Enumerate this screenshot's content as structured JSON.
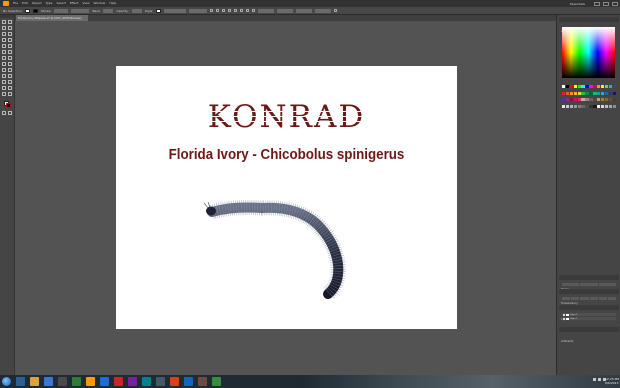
{
  "app": {
    "menu": [
      "Ai",
      "File",
      "Edit",
      "Object",
      "Type",
      "Select",
      "Effect",
      "View",
      "Window",
      "Help"
    ],
    "workspace": "Essentials",
    "document_tab": "Florida Ivory Millipede.ai* @ 100% (CMYK/Preview)",
    "control_bar": {
      "selection_label": "No Selection",
      "stroke_label": "Stroke:",
      "style_label": "Basic",
      "opacity_label": "Opacity:",
      "style2_label": "Style:",
      "doc_setup": "Document Setup",
      "preferences": "Preferences"
    }
  },
  "artboard": {
    "title": "KONRAD",
    "subtitle": "Florida Ivory - Chicobolus spinigerus"
  },
  "panels": {
    "color_header": "Color",
    "color_guide": "Color Guide",
    "swatch_colors": [
      "#ffffff",
      "#000000",
      "#ff0000",
      "#ffff00",
      "#00ff00",
      "#00ffff",
      "#0000ff",
      "#ff00ff",
      "#c8102e",
      "#f7931e",
      "#fcee21",
      "#8cc63f",
      "#29abe2",
      "#662d91",
      "#ed1c24",
      "#f15a24",
      "#f7941e",
      "#fbb03b",
      "#d9e021",
      "#39b54a",
      "#009245",
      "#006837",
      "#22b573",
      "#00a99d",
      "#29abe2",
      "#0071bc",
      "#2e3192",
      "#1b1464",
      "#662d91",
      "#93278f",
      "#9e005d",
      "#d4145a",
      "#ed1e79",
      "#c7b299",
      "#998675",
      "#736357",
      "#534741",
      "#c69c6d",
      "#a67c52",
      "#8c6239",
      "#754c24",
      "#603813",
      "#e6e6e6",
      "#cccccc",
      "#b3b3b3",
      "#999999",
      "#808080",
      "#666666",
      "#4d4d4d",
      "#333333",
      "#1a1a1a",
      "#f2f2f2",
      "#d9d9d9",
      "#bfbfbf",
      "#a6a6a6",
      "#8c8c8c"
    ],
    "stroke_header": "Stroke",
    "gradient_header": "Gradient",
    "transparency_header": "Transparency",
    "layers_header": "Layers",
    "artboards_header": "Artboards",
    "layers": [
      "Layer 2",
      "Layer 1"
    ]
  },
  "taskbar": {
    "time": "12:25 PM",
    "date": "8/6/2013"
  }
}
